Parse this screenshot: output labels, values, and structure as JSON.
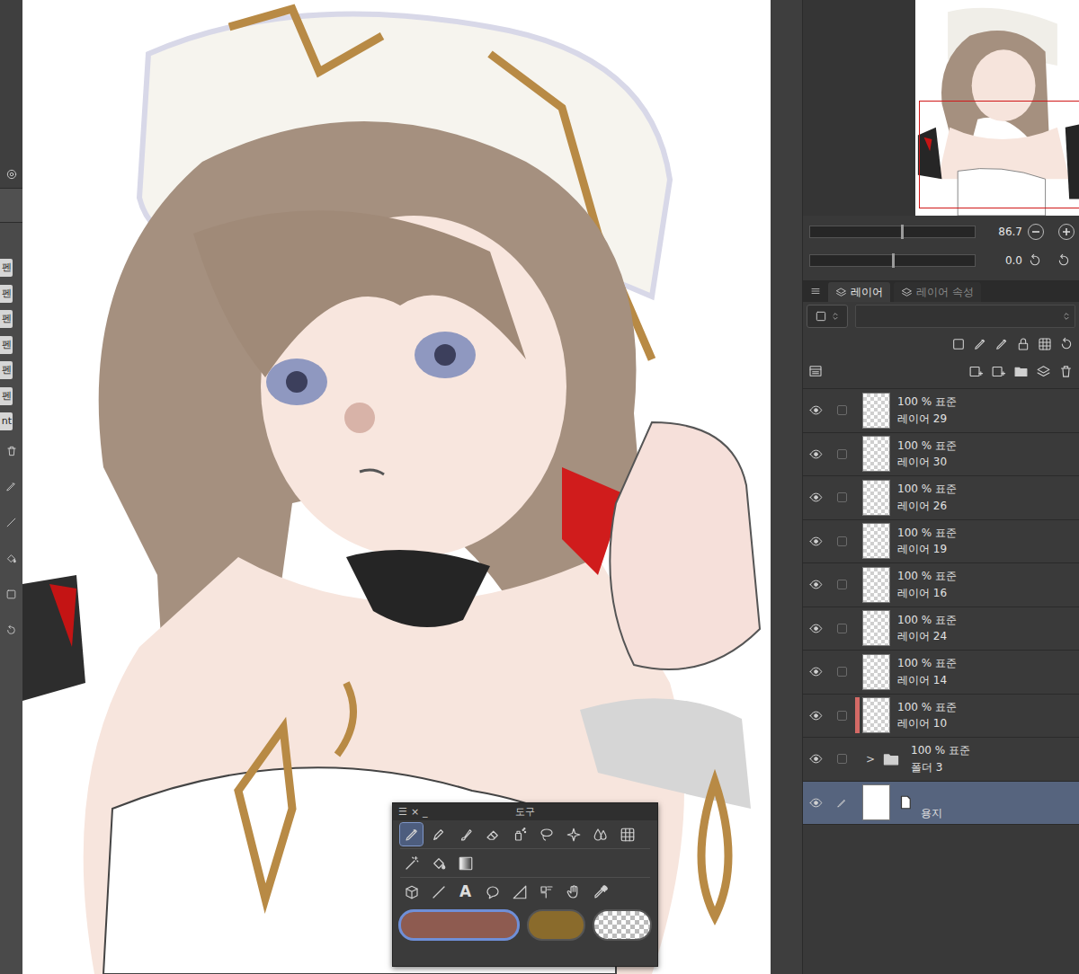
{
  "left_toolbar": {
    "items": [
      "펜",
      "펜",
      "펜",
      "펜",
      "펜",
      "펜",
      "nt"
    ]
  },
  "navigator": {
    "zoom": "86.7",
    "zoom_level": 0.56,
    "rotation": "0.0",
    "rotation_level": 0.5
  },
  "layer_panel": {
    "tabs": [
      {
        "label": "레이어",
        "selected": true
      },
      {
        "label": "레이어 속성",
        "selected": false
      }
    ],
    "layers": [
      {
        "opacity": "100 %",
        "mode": "표준",
        "name": "레이어 29",
        "visible": true,
        "selected": false,
        "kind": "layer",
        "color": null
      },
      {
        "opacity": "100 %",
        "mode": "표준",
        "name": "레이어 30",
        "visible": true,
        "selected": false,
        "kind": "layer",
        "color": null
      },
      {
        "opacity": "100 %",
        "mode": "표준",
        "name": "레이어 26",
        "visible": true,
        "selected": false,
        "kind": "layer",
        "color": null
      },
      {
        "opacity": "100 %",
        "mode": "표준",
        "name": "레이어 19",
        "visible": true,
        "selected": false,
        "kind": "layer",
        "color": null
      },
      {
        "opacity": "100 %",
        "mode": "표준",
        "name": "레이어 16",
        "visible": true,
        "selected": false,
        "kind": "layer",
        "color": null
      },
      {
        "opacity": "100 %",
        "mode": "표준",
        "name": "레이어 24",
        "visible": true,
        "selected": false,
        "kind": "layer",
        "color": null
      },
      {
        "opacity": "100 %",
        "mode": "표준",
        "name": "레이어 14",
        "visible": true,
        "selected": false,
        "kind": "layer",
        "color": null
      },
      {
        "opacity": "100 %",
        "mode": "표준",
        "name": "레이어 10",
        "visible": true,
        "selected": false,
        "kind": "layer",
        "color": "#d46a66"
      },
      {
        "opacity": "100 %",
        "mode": "표준",
        "name": "폴더 3",
        "visible": true,
        "selected": false,
        "kind": "folder",
        "color": null,
        "expander": ">",
        "expanded": false
      },
      {
        "name": "용지",
        "visible": true,
        "selected": true,
        "kind": "paper",
        "color": null
      }
    ]
  },
  "tool_palette": {
    "title": "도구",
    "controls": [
      "☰",
      "×",
      "_"
    ],
    "tool_rows": [
      [
        {
          "selected": true
        },
        {
          "selected": false
        },
        {
          "selected": false
        },
        {
          "selected": false
        },
        {
          "selected": false
        },
        {
          "selected": false
        },
        {
          "selected": false
        },
        {
          "selected": false
        },
        {
          "selected": false
        }
      ],
      [
        {
          "selected": false
        },
        {
          "selected": false
        },
        {
          "selected": false
        }
      ],
      [
        {
          "selected": false
        },
        {
          "selected": false
        },
        {
          "selected": false,
          "label": "A"
        },
        {
          "selected": false
        },
        {
          "selected": false
        },
        {
          "selected": false
        },
        {
          "selected": false
        },
        {
          "selected": false
        }
      ]
    ],
    "colors": [
      {
        "kind": "solid",
        "color": "#8e5b50",
        "selected": true
      },
      {
        "kind": "solid",
        "color": "#8a6b2c",
        "selected": false
      },
      {
        "kind": "transparent",
        "color": null,
        "selected": false
      }
    ]
  }
}
